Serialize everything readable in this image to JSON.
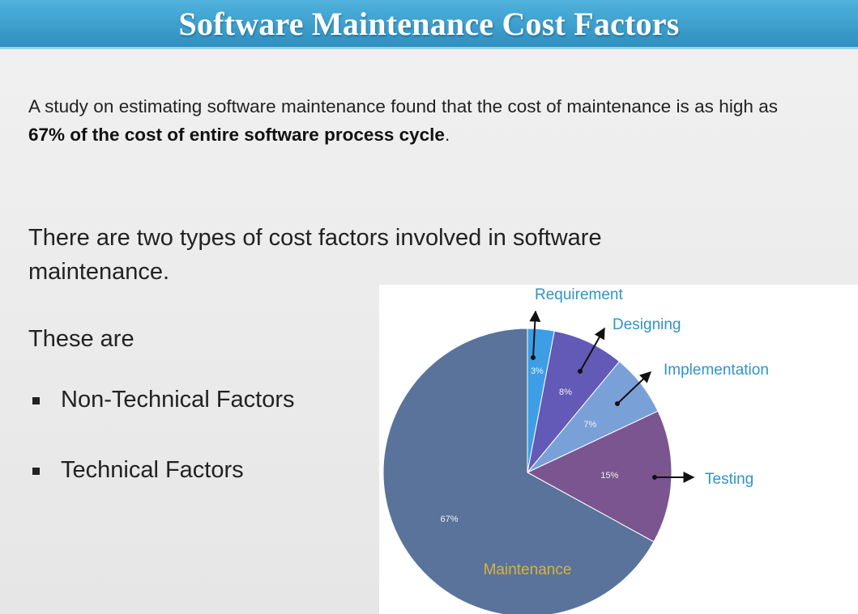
{
  "title": "Software Maintenance Cost Factors",
  "paragraph": {
    "text_before": "A study on estimating software maintenance found that the cost of maintenance is as high as ",
    "text_bold": "67% of the cost of entire software process cycle",
    "text_after": "."
  },
  "lead": "There are two types of cost factors involved in software maintenance.",
  "these_are": "These are",
  "bullets": [
    {
      "label": "Non-Technical Factors"
    },
    {
      "label": "Technical Factors"
    }
  ],
  "colors": {
    "title_bar": "#3a9fd0",
    "category_label": "#2f93c7",
    "maintenance_label": "#d9b23a"
  },
  "chart_data": {
    "type": "pie",
    "title": "",
    "unit": "%",
    "slices": [
      {
        "label": "Requirement",
        "value": 3,
        "value_label": "3%",
        "color": "#3d9ee6"
      },
      {
        "label": "Designing",
        "value": 8,
        "value_label": "8%",
        "color": "#6359b6"
      },
      {
        "label": "Implementation",
        "value": 7,
        "value_label": "7%",
        "color": "#7aa1d7"
      },
      {
        "label": "Testing",
        "value": 15,
        "value_label": "15%",
        "color": "#7a558f"
      },
      {
        "label": "Maintenance",
        "value": 67,
        "value_label": "67%",
        "color": "#59739b"
      }
    ]
  }
}
